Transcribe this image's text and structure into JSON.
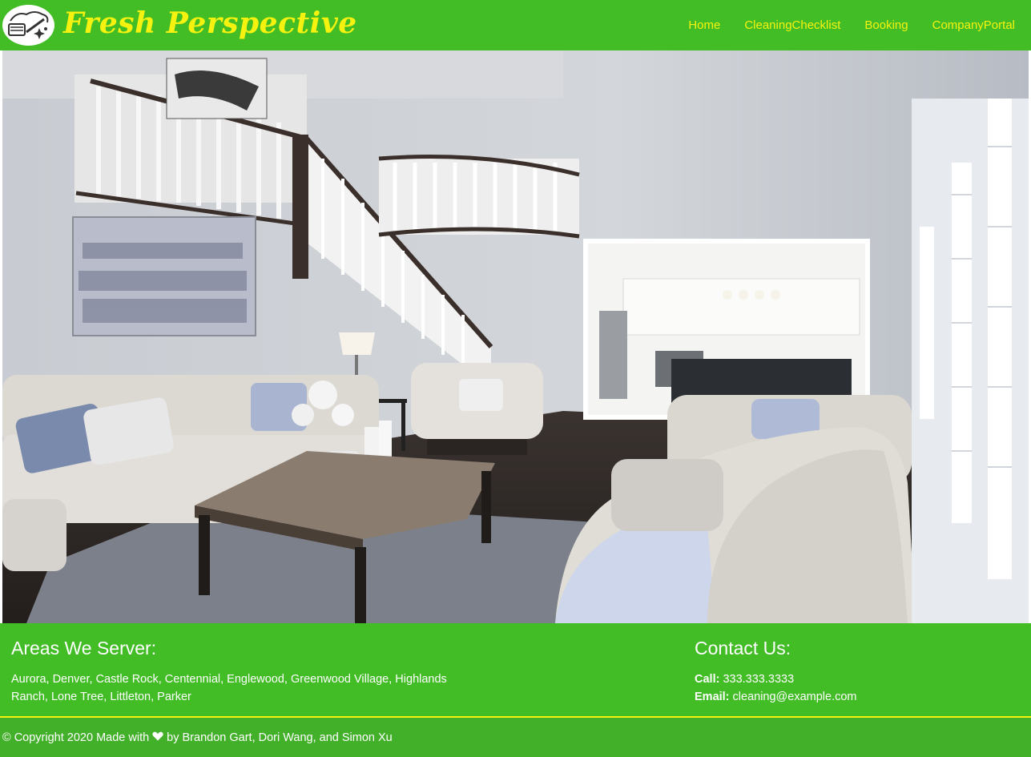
{
  "brand": {
    "name": "Fresh Perspective",
    "logo_icon": "cleaning-broom-icon"
  },
  "nav": {
    "items": [
      {
        "label": "Home"
      },
      {
        "label": "CleaningChecklist"
      },
      {
        "label": "Booking"
      },
      {
        "label": "CompanyPortal"
      }
    ]
  },
  "hero": {
    "image": "living-room-photo"
  },
  "areas": {
    "title": "Areas We Server:",
    "text": "Aurora, Denver, Castle Rock, Centennial, Englewood, Greenwood Village, Highlands Ranch, Lone Tree, Littleton, Parker"
  },
  "contact": {
    "title": "Contact Us:",
    "call_label": "Call:",
    "call_value": "333.333.3333",
    "email_label": "Email:",
    "email_value": "cleaning@example.com"
  },
  "footer": {
    "copyright_prefix": "© Copyright 2020 Made with",
    "heart_icon": "heart-icon",
    "copyright_suffix": "by Brandon Gart, Dori Wang, and Simon Xu"
  },
  "colors": {
    "primary_green": "#43bd26",
    "accent_yellow": "#f5f20f",
    "footer_green": "#43b02a"
  }
}
